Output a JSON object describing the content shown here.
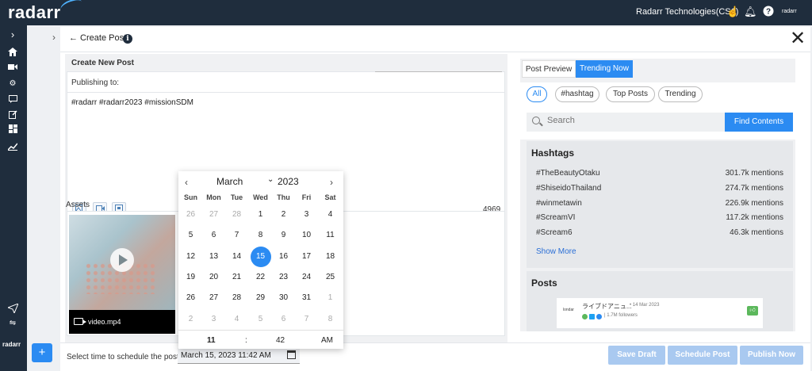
{
  "topbar": {
    "logo": "radarr",
    "org_name": "Radarr Technologies(CS1)",
    "brand_small": "radarr"
  },
  "sidebar": {
    "brand_bottom": "radarr"
  },
  "header": {
    "back_label": "← Create Post",
    "info_glyph": "i",
    "close_glyph": "✕",
    "collapse_glyph": "›"
  },
  "compose": {
    "section_title": "Create New Post",
    "publishing_label": "Publishing to:",
    "text": "#radarr #radarr2023 #missionSDM",
    "char_count": "4969"
  },
  "assets": {
    "title": "Assets",
    "file_name": "video.mp4"
  },
  "footer": {
    "schedule_label": "Select time to schedule the post :",
    "schedule_value": "March 15, 2023 11:42 AM",
    "save_draft": "Save Draft",
    "schedule_post": "Schedule Post",
    "publish_now": "Publish Now"
  },
  "calendar": {
    "prev_glyph": "‹",
    "next_glyph": "›",
    "month": "March",
    "month_caret": "⌄",
    "year": "2023",
    "weekdays": [
      "Sun",
      "Mon",
      "Tue",
      "Wed",
      "Thu",
      "Fri",
      "Sat"
    ],
    "weeks": [
      [
        {
          "d": "26",
          "m": true
        },
        {
          "d": "27",
          "m": true
        },
        {
          "d": "28",
          "m": true
        },
        {
          "d": "1"
        },
        {
          "d": "2"
        },
        {
          "d": "3"
        },
        {
          "d": "4"
        }
      ],
      [
        {
          "d": "5"
        },
        {
          "d": "6"
        },
        {
          "d": "7"
        },
        {
          "d": "8"
        },
        {
          "d": "9"
        },
        {
          "d": "10"
        },
        {
          "d": "11"
        }
      ],
      [
        {
          "d": "12"
        },
        {
          "d": "13"
        },
        {
          "d": "14"
        },
        {
          "d": "15",
          "s": true
        },
        {
          "d": "16"
        },
        {
          "d": "17"
        },
        {
          "d": "18"
        }
      ],
      [
        {
          "d": "19"
        },
        {
          "d": "20"
        },
        {
          "d": "21"
        },
        {
          "d": "22"
        },
        {
          "d": "23"
        },
        {
          "d": "24"
        },
        {
          "d": "25"
        }
      ],
      [
        {
          "d": "26"
        },
        {
          "d": "27"
        },
        {
          "d": "28"
        },
        {
          "d": "29"
        },
        {
          "d": "30"
        },
        {
          "d": "31"
        },
        {
          "d": "1",
          "m": true
        }
      ],
      [
        {
          "d": "2",
          "m": true
        },
        {
          "d": "3",
          "m": true
        },
        {
          "d": "4",
          "m": true
        },
        {
          "d": "5",
          "m": true
        },
        {
          "d": "6",
          "m": true
        },
        {
          "d": "7",
          "m": true
        },
        {
          "d": "8",
          "m": true
        }
      ]
    ],
    "time": {
      "hour": "11",
      "sep": ":",
      "minute": "42",
      "ampm": "AM"
    }
  },
  "right": {
    "tabs": [
      "Post Preview",
      "Trending Now"
    ],
    "filters": [
      "All",
      "#hashtag",
      "Top Posts",
      "Trending"
    ],
    "search_placeholder": "Search",
    "find_label": "Find Contents",
    "hashtags_title": "Hashtags",
    "hashtags": [
      {
        "tag": "#TheBeautyOtaku",
        "count": "301.7k mentions"
      },
      {
        "tag": "#ShiseidoThailand",
        "count": "274.7k mentions"
      },
      {
        "tag": "#winmetawin",
        "count": "226.9k mentions"
      },
      {
        "tag": "#ScreamVI",
        "count": "117.2k mentions"
      },
      {
        "tag": "#Scream6",
        "count": "46.3k mentions"
      }
    ],
    "show_more": "Show More",
    "posts_title": "Posts",
    "post": {
      "logo_text": "londar",
      "name": "ライブドアニュ...",
      "date": "• 14 Mar 2023",
      "followers": "| 1.7M followers"
    }
  },
  "colors": {
    "accent": "#2b8bf2",
    "dark": "#1f2d3d",
    "disabled": "#a9c9f0"
  }
}
